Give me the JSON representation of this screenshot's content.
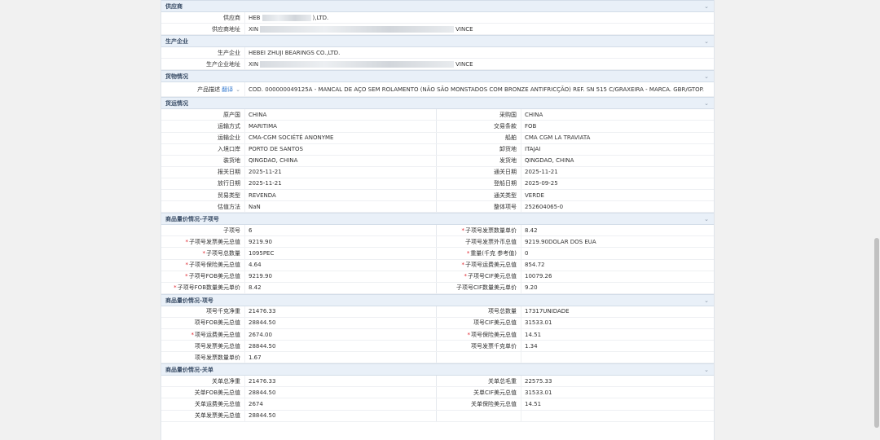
{
  "supplier": {
    "header": "供应商",
    "rows": [
      {
        "label": "供应商",
        "value_start": "HEB",
        "value_end": "),LTD."
      },
      {
        "label": "供应商地址",
        "value_start": "XIN",
        "value_end": "VINCE"
      }
    ]
  },
  "producer": {
    "header": "生产企业",
    "rows": [
      {
        "label": "生产企业",
        "value": "HEBEI ZHUJI BEARINGS CO.,LTD."
      },
      {
        "label": "生产企业地址",
        "value_start": "XIN",
        "value_end": "VINCE"
      }
    ]
  },
  "goods": {
    "header": "货物情况",
    "label": "产品描述",
    "translate": "翻译",
    "arrow": "⌄",
    "value": "COD. 000000049125A - MANCAL DE AÇO SEM ROLAMENTO (NÃO SÃO MONSTADOS COM BRONZE ANTIFRICÇÃO) REF. SN 515 C/GRAXEIRA - MARCA. GBR/GTOP."
  },
  "transport": {
    "header": "货运情况",
    "rows": [
      [
        {
          "label": "原产国",
          "value": "CHINA"
        },
        {
          "label": "采购国",
          "value": "CHINA"
        }
      ],
      [
        {
          "label": "运输方式",
          "value": "MARITIMA"
        },
        {
          "label": "交易条款",
          "value": "FOB"
        }
      ],
      [
        {
          "label": "运输企业",
          "value": "CMA-CGM SOCIÉTÉ ANONYME"
        },
        {
          "label": "船舶",
          "value": "CMA CGM LA TRAVIATA"
        }
      ],
      [
        {
          "label": "入境口岸",
          "value": "PORTO DE SANTOS"
        },
        {
          "label": "卸货地",
          "value": "ITAJAI"
        }
      ],
      [
        {
          "label": "装货地",
          "value": "QINGDAO, CHINA"
        },
        {
          "label": "发货地",
          "value": "QINGDAO, CHINA"
        }
      ],
      [
        {
          "label": "报关日期",
          "value": "2025-11-21"
        },
        {
          "label": "通关日期",
          "value": "2025-11-21"
        }
      ],
      [
        {
          "label": "放行日期",
          "value": "2025-11-21"
        },
        {
          "label": "登船日期",
          "value": "2025-09-25"
        }
      ],
      [
        {
          "label": "贸易类型",
          "value": "REVENDA"
        },
        {
          "label": "通关类型",
          "value": "VERDE"
        }
      ],
      [
        {
          "label": "估值方法",
          "value": "NaN"
        },
        {
          "label": "整体项号",
          "value": "252604065-0"
        }
      ]
    ]
  },
  "subitem": {
    "header": "商品量价情况-子项号",
    "rows": [
      [
        {
          "label": "子项号",
          "value": "6",
          "req": false
        },
        {
          "label": "子项号发票数量单价",
          "value": "8.42",
          "req": true
        }
      ],
      [
        {
          "label": "子项号发票美元总值",
          "value": "9219.90",
          "req": true
        },
        {
          "label": "子项号发票外币总值",
          "value": "9219.90DOLAR DOS EUA",
          "req": false
        }
      ],
      [
        {
          "label": "子项号总数量",
          "value": "1095PEC",
          "req": true
        },
        {
          "label": "重量(千克 参考值)",
          "value": "0",
          "req": true
        }
      ],
      [
        {
          "label": "子项号保险美元总值",
          "value": "4.64",
          "req": true
        },
        {
          "label": "子项号运费美元总值",
          "value": "854.72",
          "req": true
        }
      ],
      [
        {
          "label": "子项号FOB美元总值",
          "value": "9219.90",
          "req": true
        },
        {
          "label": "子项号CIF美元总值",
          "value": "10079.26",
          "req": true
        }
      ],
      [
        {
          "label": "子项号FOB数量美元单价",
          "value": "8.42",
          "req": true
        },
        {
          "label": "子项号CIF数量美元单价",
          "value": "9.20",
          "req": false
        }
      ]
    ]
  },
  "item": {
    "header": "商品量价情况-项号",
    "rows": [
      [
        {
          "label": "项号千克净重",
          "value": "21476.33",
          "req": false
        },
        {
          "label": "项号总数量",
          "value": "17317UNIDADE",
          "req": false
        }
      ],
      [
        {
          "label": "项号FOB美元总值",
          "value": "28844.50",
          "req": false
        },
        {
          "label": "项号CIF美元总值",
          "value": "31533.01",
          "req": false
        }
      ],
      [
        {
          "label": "项号运费美元总值",
          "value": "2674.00",
          "req": true
        },
        {
          "label": "项号保险美元总值",
          "value": "14.51",
          "req": true
        }
      ],
      [
        {
          "label": "项号发票美元总值",
          "value": "28844.50",
          "req": false
        },
        {
          "label": "项号发票千克单价",
          "value": "1.34",
          "req": false
        }
      ],
      [
        {
          "label": "项号发票数量单价",
          "value": "1.67",
          "req": false
        },
        null
      ]
    ]
  },
  "customs": {
    "header": "商品量价情况-关单",
    "rows": [
      [
        {
          "label": "关单总净重",
          "value": "21476.33"
        },
        {
          "label": "关单总毛重",
          "value": "22575.33"
        }
      ],
      [
        {
          "label": "关单FOB美元总值",
          "value": "28844.50"
        },
        {
          "label": "关单CIF美元总值",
          "value": "31533.01"
        }
      ],
      [
        {
          "label": "关单运费美元总值",
          "value": "2674"
        },
        {
          "label": "关单保险美元总值",
          "value": "14.51"
        }
      ],
      [
        {
          "label": "关单发票美元总值",
          "value": "28844.50"
        },
        null
      ]
    ]
  },
  "ui": {
    "chevron": "⌄",
    "required_mark": "*"
  }
}
